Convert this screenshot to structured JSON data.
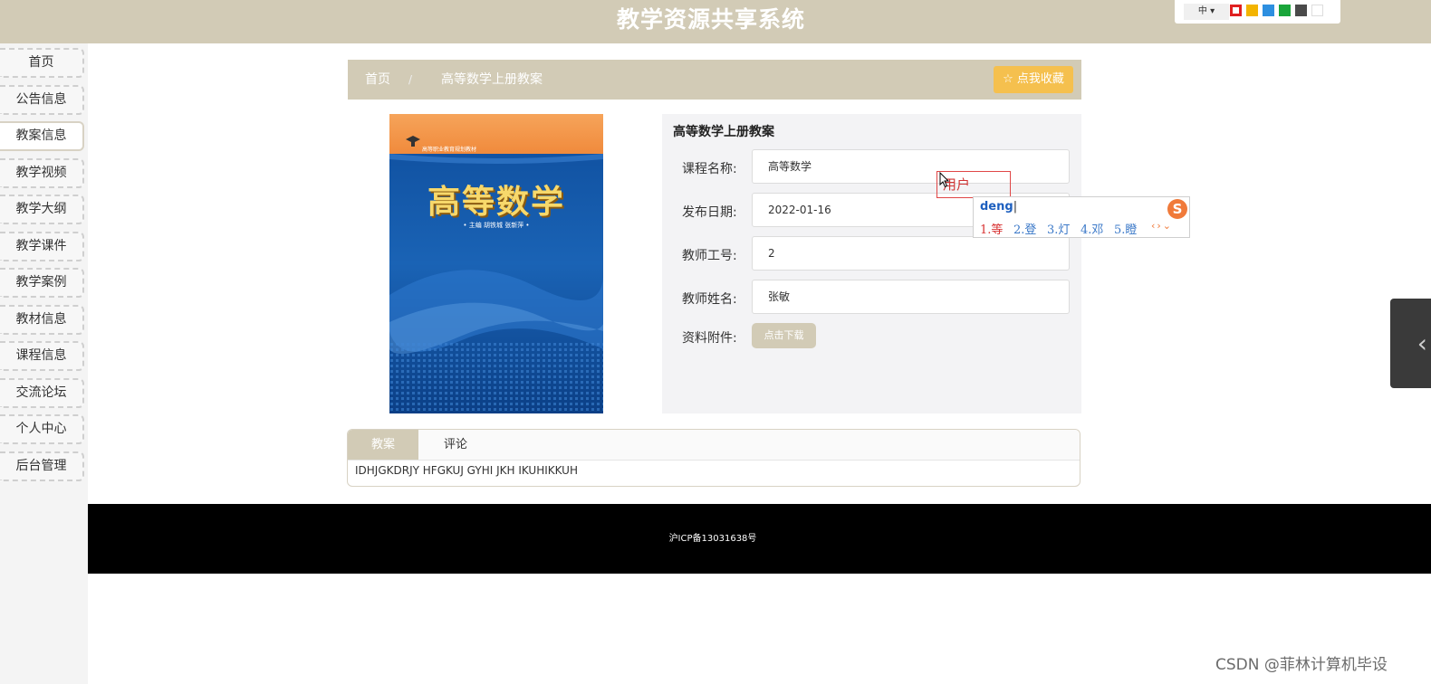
{
  "header": {
    "site_title": "教学资源共享系统",
    "language": "中",
    "theme_colors": [
      "#e02020",
      "#f3b400",
      "#2d8fe0",
      "#1aa53a",
      "#4a4a4a",
      "#ffffff"
    ]
  },
  "sidebar": {
    "items": [
      {
        "label": "首页"
      },
      {
        "label": "公告信息"
      },
      {
        "label": "教案信息"
      },
      {
        "label": "教学视频"
      },
      {
        "label": "教学大纲"
      },
      {
        "label": "教学课件"
      },
      {
        "label": "教学案例"
      },
      {
        "label": "教材信息"
      },
      {
        "label": "课程信息"
      },
      {
        "label": "交流论坛"
      },
      {
        "label": "个人中心"
      },
      {
        "label": "后台管理"
      }
    ],
    "active_index": 2
  },
  "breadcrumb": {
    "home": "首页",
    "separator": "/",
    "current": "高等数学上册教案",
    "favorite_button": "☆ 点我收藏"
  },
  "cover": {
    "title": "高等数学",
    "top_text": "高等职业教育规划教材",
    "authors": "• 主编 胡铁城 张新萍 •"
  },
  "details": {
    "title": "高等数学上册教案",
    "fields": [
      {
        "label": "课程名称:",
        "value": "高等数学"
      },
      {
        "label": "发布日期:",
        "value": "2022-01-16"
      },
      {
        "label": "教师工号:",
        "value": "2"
      },
      {
        "label": "教师姓名:",
        "value": "张敏"
      }
    ],
    "attachment_label": "资料附件:",
    "download_button": "点击下载"
  },
  "tabs": {
    "items": [
      {
        "label": "教案"
      },
      {
        "label": "评论"
      }
    ],
    "active_index": 0,
    "content": "IDHJGKDRJY HFGKUJ GYHI JKH IKUHIKKUH"
  },
  "footer": {
    "icp": "沪ICP备13031638号"
  },
  "ime": {
    "hint": "用户",
    "input": "deng",
    "candidates": [
      "1.等",
      "2.登",
      "3.灯",
      "4.邓",
      "5.瞪"
    ],
    "logo": "S"
  },
  "watermark": "CSDN @菲林计算机毕设"
}
